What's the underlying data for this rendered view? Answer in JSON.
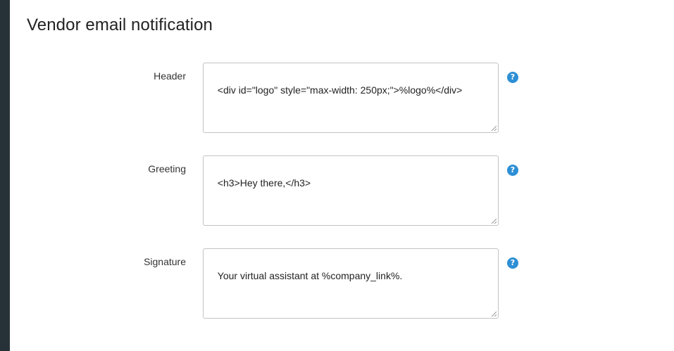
{
  "page": {
    "title": "Vendor email notification"
  },
  "fields": [
    {
      "label": "Header",
      "value": "<div id=\"logo\" style=\"max-width: 250px;\">%logo%</div>",
      "help_icon": "question-circle-icon"
    },
    {
      "label": "Greeting",
      "value": "<h3>Hey there,</h3>",
      "help_icon": "question-circle-icon"
    },
    {
      "label": "Signature",
      "value": "Your virtual assistant at %company_link%.",
      "help_icon": "question-circle-icon"
    }
  ],
  "colors": {
    "sidebar": "#263238",
    "help_icon": "#2d8fd5",
    "border": "#c3c3c3"
  }
}
